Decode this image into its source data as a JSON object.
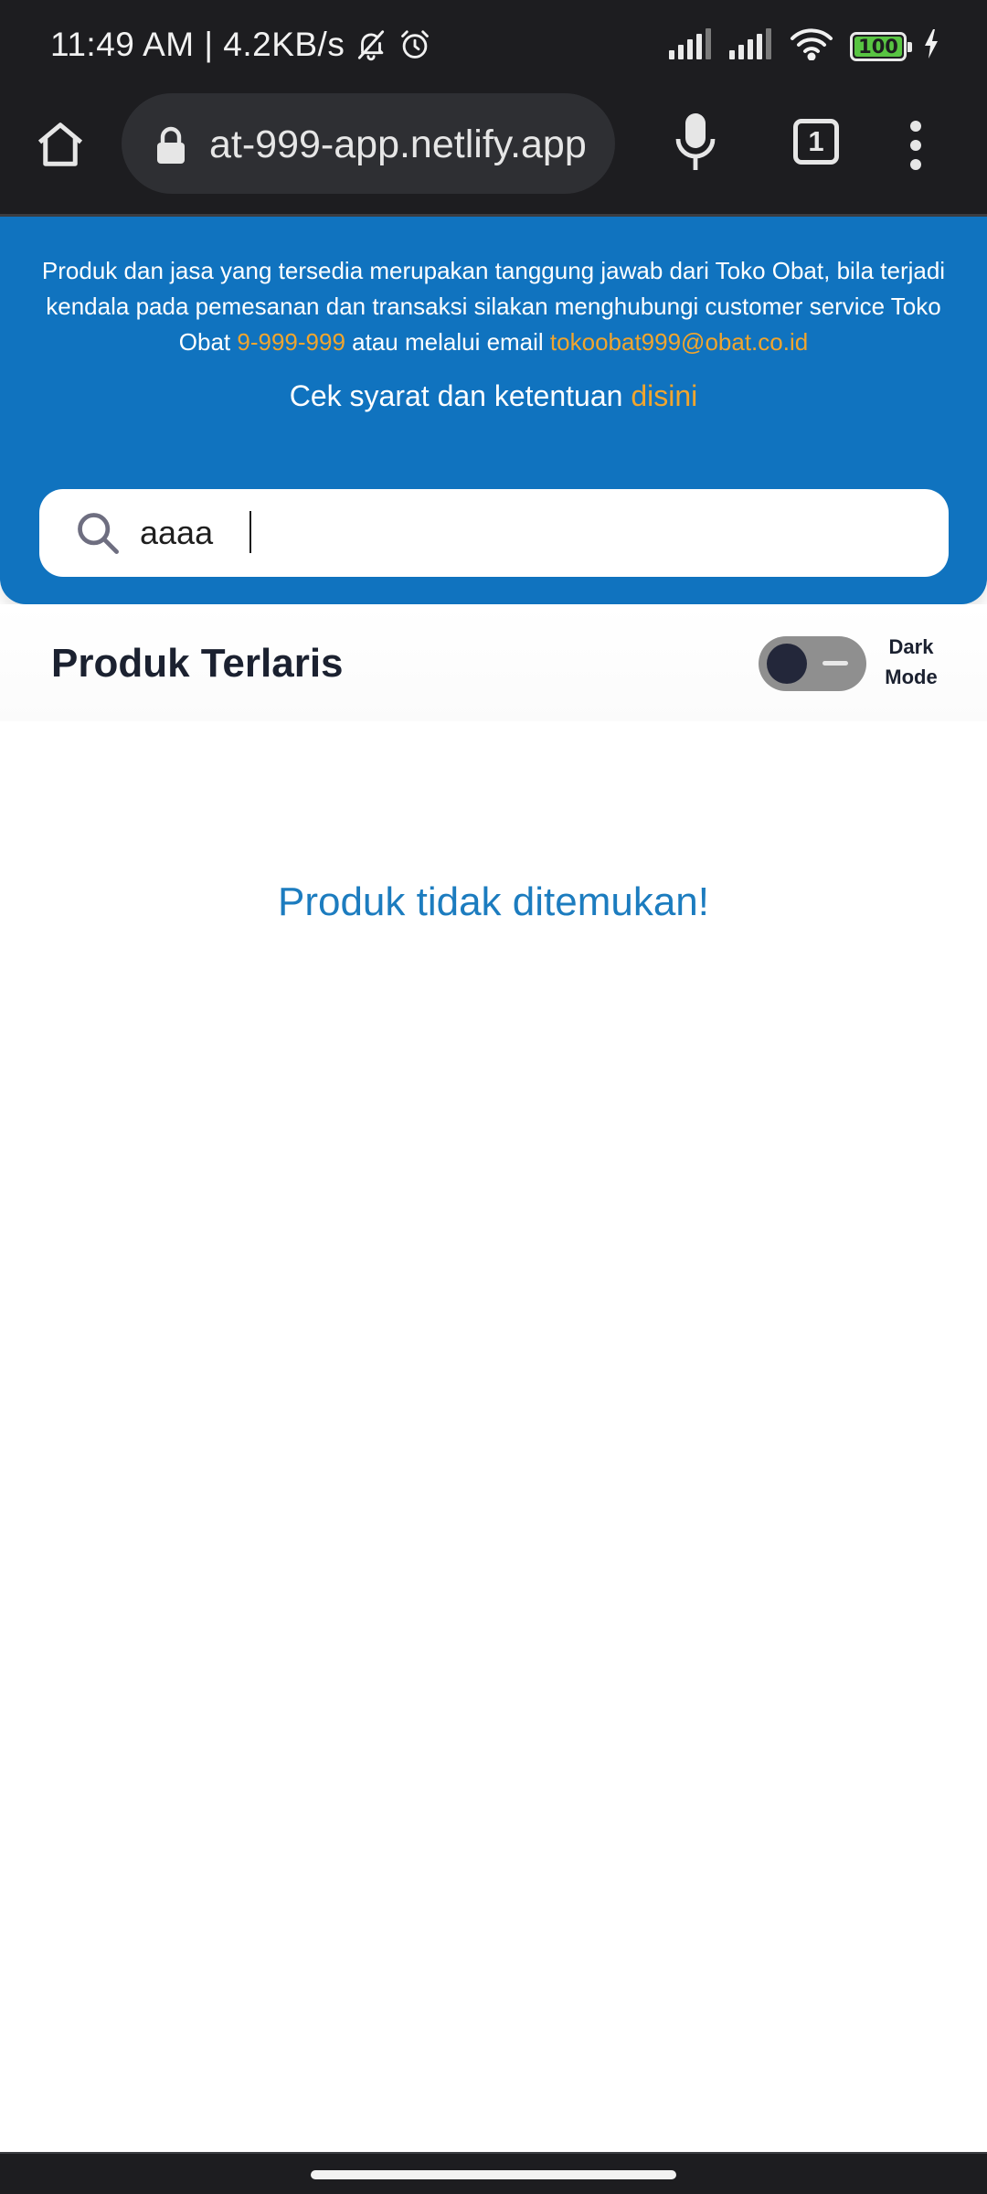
{
  "status_bar": {
    "time_speed": "11:49 AM | 4.2KB/s",
    "battery": "100"
  },
  "browser": {
    "url": "at-999-app.netlify.app",
    "tab_count": "1"
  },
  "info": {
    "text_before_phone": "Produk dan jasa yang tersedia merupakan tanggung jawab dari Toko Obat, bila terjadi kendala pada pemesanan dan transaksi silakan menghubungi customer service Toko Obat ",
    "phone": "9-999-999",
    "text_between": " atau melalui email ",
    "email": "tokoobat999@obat.co.id",
    "terms_prefix": "Cek syarat dan ketentuan ",
    "terms_link": "disini"
  },
  "search": {
    "value": "aaaa"
  },
  "section": {
    "title": "Produk Terlaris",
    "dark_mode_label_1": "Dark",
    "dark_mode_label_2": "Mode"
  },
  "empty_message": "Produk tidak ditemukan!",
  "colors": {
    "accent_blue": "#1073bf",
    "highlight_orange": "#f0a52e",
    "message_blue": "#1c7cbf"
  }
}
